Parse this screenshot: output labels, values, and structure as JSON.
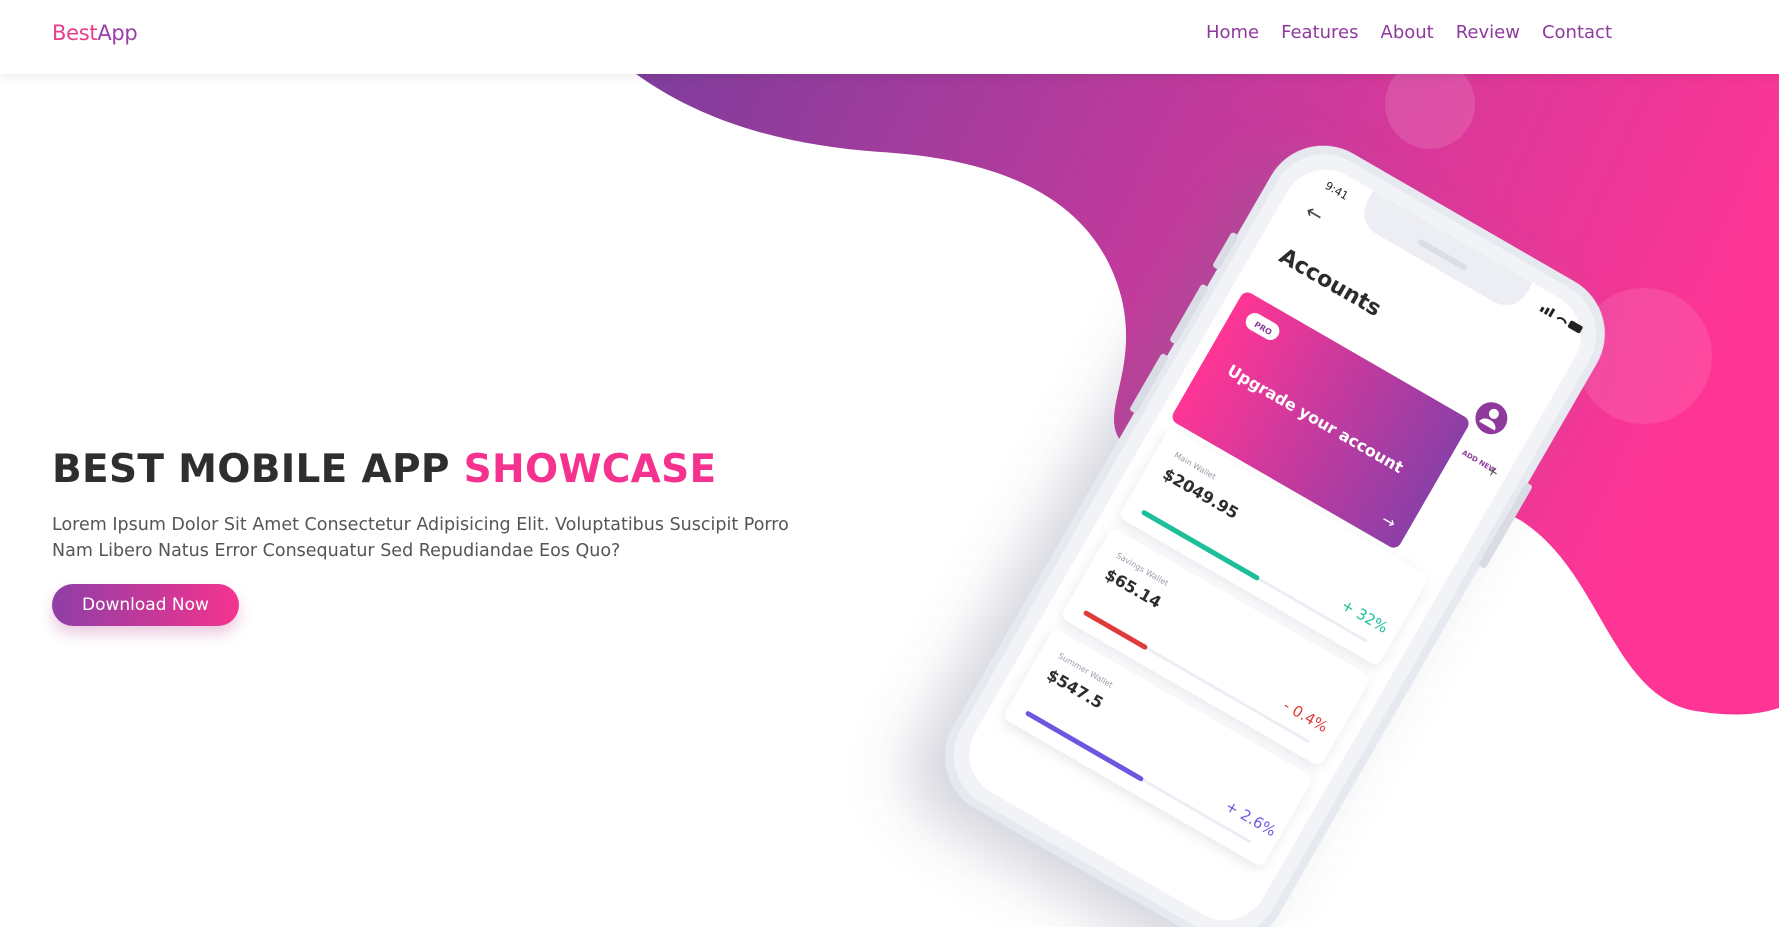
{
  "brand": {
    "part1": "Best",
    "part2": "App"
  },
  "nav": {
    "items": [
      "Home",
      "Features",
      "About",
      "Review",
      "Contact"
    ]
  },
  "hero": {
    "title_main": "BEST MOBILE APP",
    "title_highlight": "SHOWCASE",
    "description": "Lorem Ipsum Dolor Sit Amet Consectetur Adipisicing Elit. Voluptatibus Suscipit Porro Nam Libero Natus Error Consequatur Sed Repudiandae Eos Quo?",
    "cta_label": "Download Now"
  },
  "phone": {
    "time": "9:41",
    "screen_title": "Accounts",
    "badge": "PRO",
    "add_new": "ADD NEW",
    "upgrade": "Upgrade your account",
    "wallets": [
      {
        "name": "Main Wallet",
        "amount": "$2049.95",
        "change": "+ 32%",
        "progress": 0.52,
        "color": "#1dbf9a"
      },
      {
        "name": "Savings Wallet",
        "amount": "$65.14",
        "change": "- 0.4%",
        "progress": 0.28,
        "color": "#e03b3b"
      },
      {
        "name": "Summer Wallet",
        "amount": "$547.5",
        "change": "+ 2.6%",
        "progress": 0.52,
        "color": "#6b57e0"
      }
    ]
  },
  "colors": {
    "accent_pink": "#f5338f",
    "accent_purple": "#8e3fa6",
    "nav_link": "#8e3a9d"
  }
}
